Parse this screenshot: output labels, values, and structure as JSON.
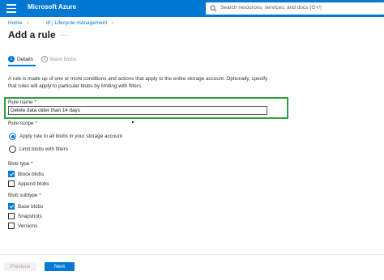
{
  "header": {
    "brand": "Microsoft Azure",
    "search_placeholder": "Search resources, services, and docs (G+/)",
    "accent": "#0078d4"
  },
  "breadcrumb": {
    "items": [
      "Home",
      "dl | Lifecycle management"
    ]
  },
  "page": {
    "title": "Add a rule",
    "more": "···"
  },
  "tabs": [
    {
      "number": "1",
      "label": "Details"
    },
    {
      "number": "2",
      "label": "Base blobs"
    }
  ],
  "description": "A rule is made up of one or more conditions and actions that apply to the entire storage account. Optionally, specify that rules will apply to particular blobs by limiting with filters.",
  "form": {
    "rule_name_label": "Rule name *",
    "rule_name_value": "Delete data older than 14 days",
    "highlight_color": "#2e9e3e",
    "rule_scope_label": "Rule scope *",
    "scope_options": [
      {
        "label": "Apply rule to all blobs in your storage account",
        "selected": true
      },
      {
        "label": "Limit blobs with filters",
        "selected": false
      }
    ],
    "blob_type_label": "Blob type *",
    "blob_types": [
      {
        "label": "Block blobs",
        "checked": true
      },
      {
        "label": "Append blobs",
        "checked": false
      }
    ],
    "blob_subtype_label": "Blob subtype *",
    "blob_subtypes": [
      {
        "label": "Base blobs",
        "checked": true
      },
      {
        "label": "Snapshots",
        "checked": false
      },
      {
        "label": "Versions",
        "checked": false
      }
    ]
  },
  "footer": {
    "previous_label": "Previous",
    "next_label": "Next"
  }
}
